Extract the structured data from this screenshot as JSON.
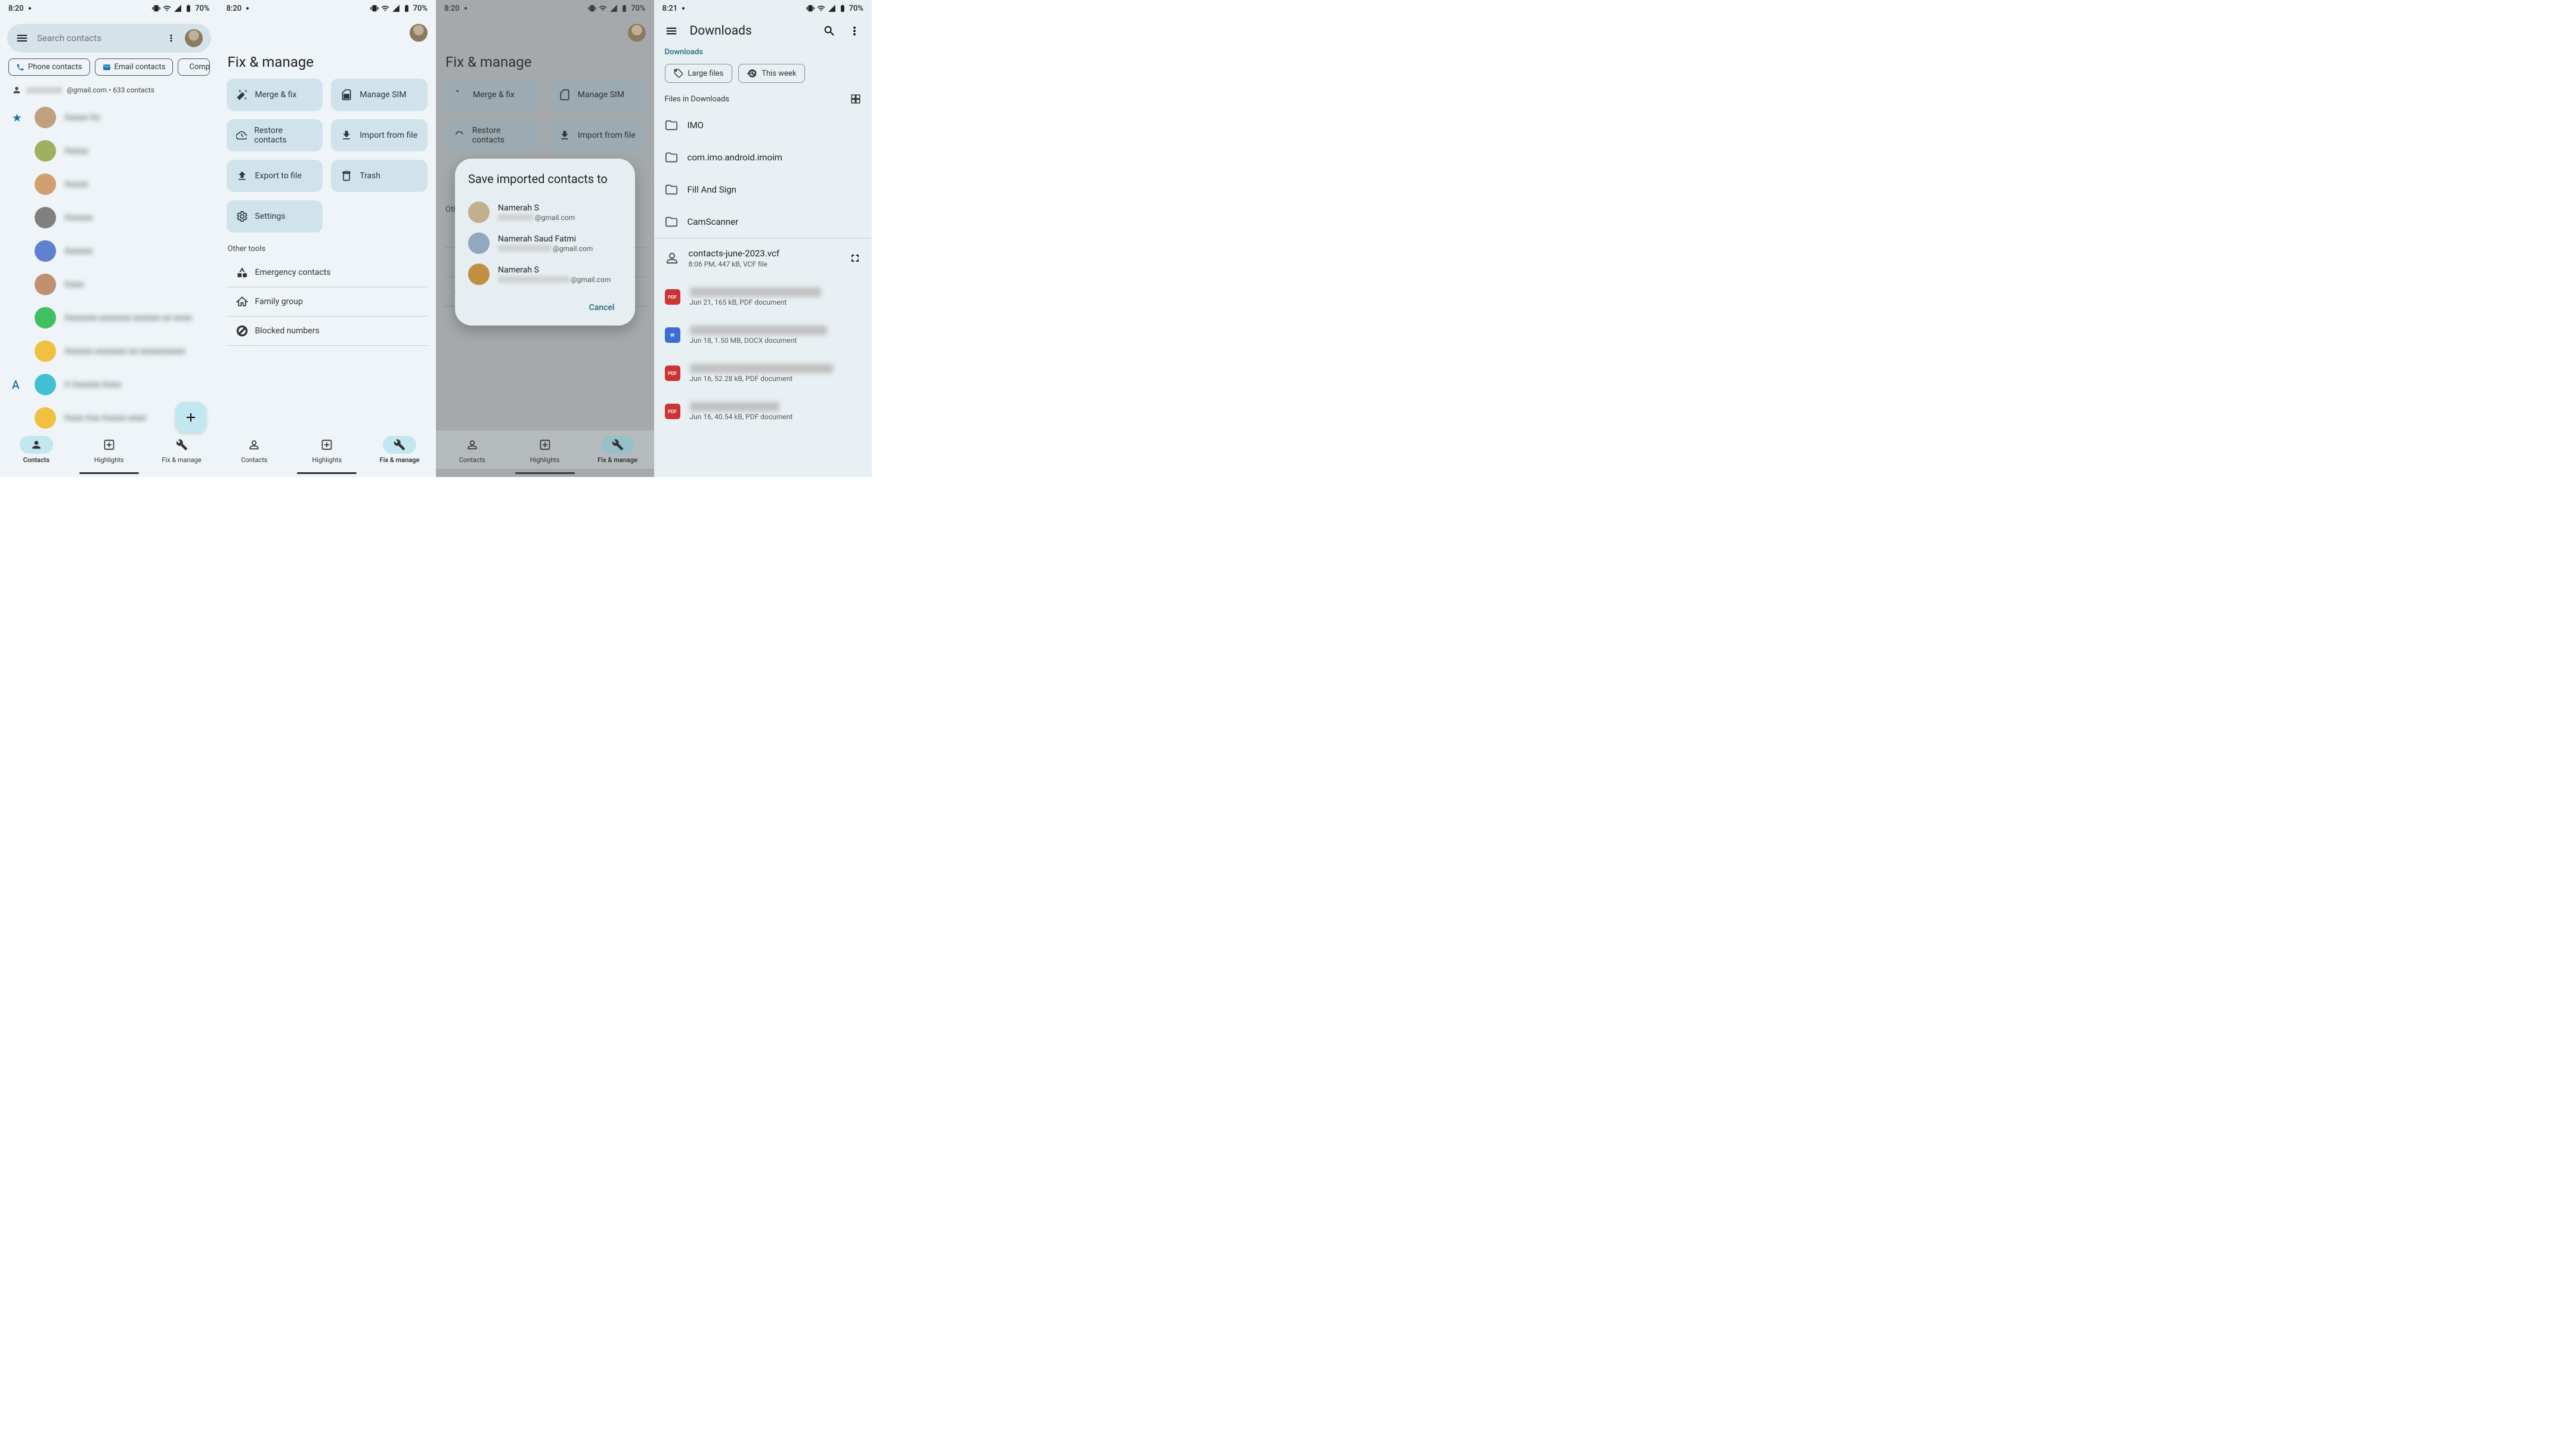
{
  "status": {
    "time1": "8:20",
    "time4": "8:21",
    "battery": "70%"
  },
  "screen1": {
    "search_placeholder": "Search contacts",
    "chips": {
      "phone": "Phone contacts",
      "email": "Email contacts",
      "company": "Compa"
    },
    "account_suffix": "@gmail.com • 633 contacts",
    "section_a": "A",
    "nav": {
      "contacts": "Contacts",
      "highlights": "Highlights",
      "fix": "Fix & manage"
    }
  },
  "screen2": {
    "title": "Fix & manage",
    "tools": {
      "merge": "Merge & fix",
      "sim": "Manage SIM",
      "restore": "Restore contacts",
      "import": "Import from file",
      "export": "Export to file",
      "trash": "Trash",
      "settings": "Settings"
    },
    "other_title": "Other tools",
    "other": {
      "emergency": "Emergency contacts",
      "family": "Family group",
      "blocked": "Blocked numbers"
    }
  },
  "screen3": {
    "dialog_title": "Save imported contacts to",
    "accounts": [
      {
        "name": "Namerah S",
        "suffix": "@gmail.com"
      },
      {
        "name": "Namerah Saud Fatmi",
        "suffix": "@gmail.com"
      },
      {
        "name": "Namerah S",
        "suffix": "@gmail.com"
      }
    ],
    "cancel": "Cancel"
  },
  "screen4": {
    "title": "Downloads",
    "path": "Downloads",
    "chips": {
      "large": "Large files",
      "week": "This week"
    },
    "section": "Files in Downloads",
    "folders": [
      "IMO",
      "com.imo.android.imoim",
      "Fill And Sign",
      "CamScanner"
    ],
    "vcf": {
      "name": "contacts-june-2023.vcf",
      "meta": "8:06 PM, 447 kB, VCF file"
    },
    "files": [
      {
        "type": "pdf",
        "meta": "Jun 21, 165 kB, PDF document"
      },
      {
        "type": "docx",
        "meta": "Jun 18, 1.50 MB, DOCX document"
      },
      {
        "type": "pdf",
        "meta": "Jun 16, 52.28 kB, PDF document"
      },
      {
        "type": "pdf",
        "meta": "Jun 16, 40.54 kB, PDF document"
      }
    ]
  }
}
